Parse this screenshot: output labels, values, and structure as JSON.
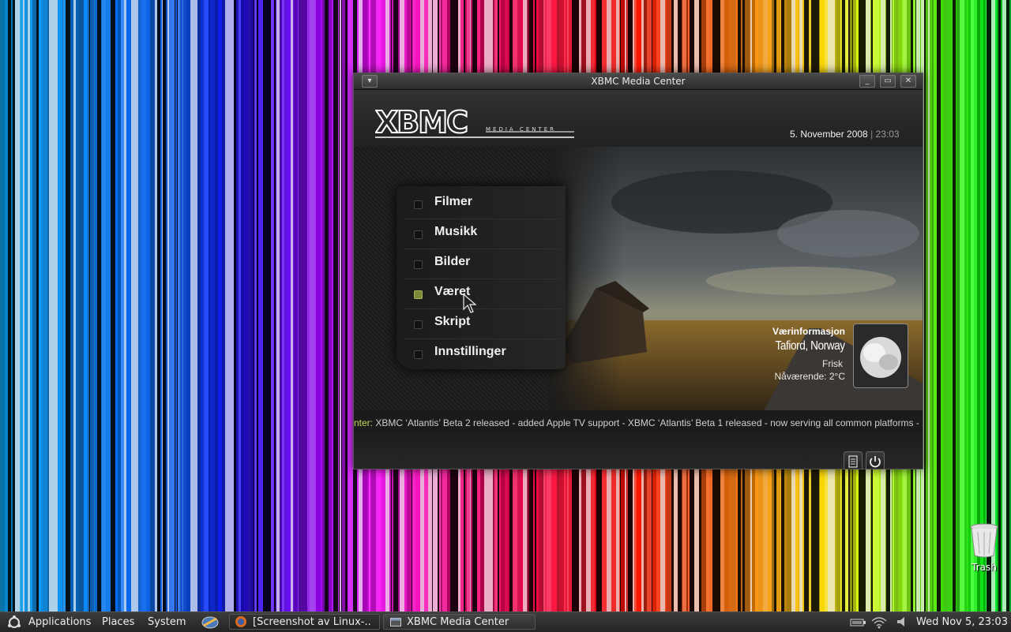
{
  "window": {
    "title": "XBMC Media Center"
  },
  "header": {
    "date": "5. November 2008",
    "separator": "|",
    "time": "23:03"
  },
  "menu": {
    "items": [
      {
        "label": "Filmer",
        "active": false
      },
      {
        "label": "Musikk",
        "active": false
      },
      {
        "label": "Bilder",
        "active": false
      },
      {
        "label": "Været",
        "active": true
      },
      {
        "label": "Skript",
        "active": false
      },
      {
        "label": "Innstillinger",
        "active": false
      }
    ]
  },
  "weather": {
    "heading": "Værinformasjon",
    "location": "Tafiord, Norway",
    "condition": "Frisk",
    "current": "Nåværende:  2°C"
  },
  "ticker": {
    "prefix": "nter:",
    "text": " XBMC ‘Atlantis’ Beta 2 released - added Apple TV support - XBMC ‘Atlantis’ Beta 1 released - now serving all common platforms - XBMC ‘A"
  },
  "desktop": {
    "trash_label": "Trash"
  },
  "taskbar": {
    "applications": "Applications",
    "places": "Places",
    "system": "System",
    "task_screenshot": "[Screenshot av Linux-...",
    "task_xbmc": "XBMC Media Center",
    "clock": "Wed Nov  5, 23:03"
  },
  "colors": {
    "accent": "#a3b350",
    "ticker_prefix": "#c8d45a"
  }
}
